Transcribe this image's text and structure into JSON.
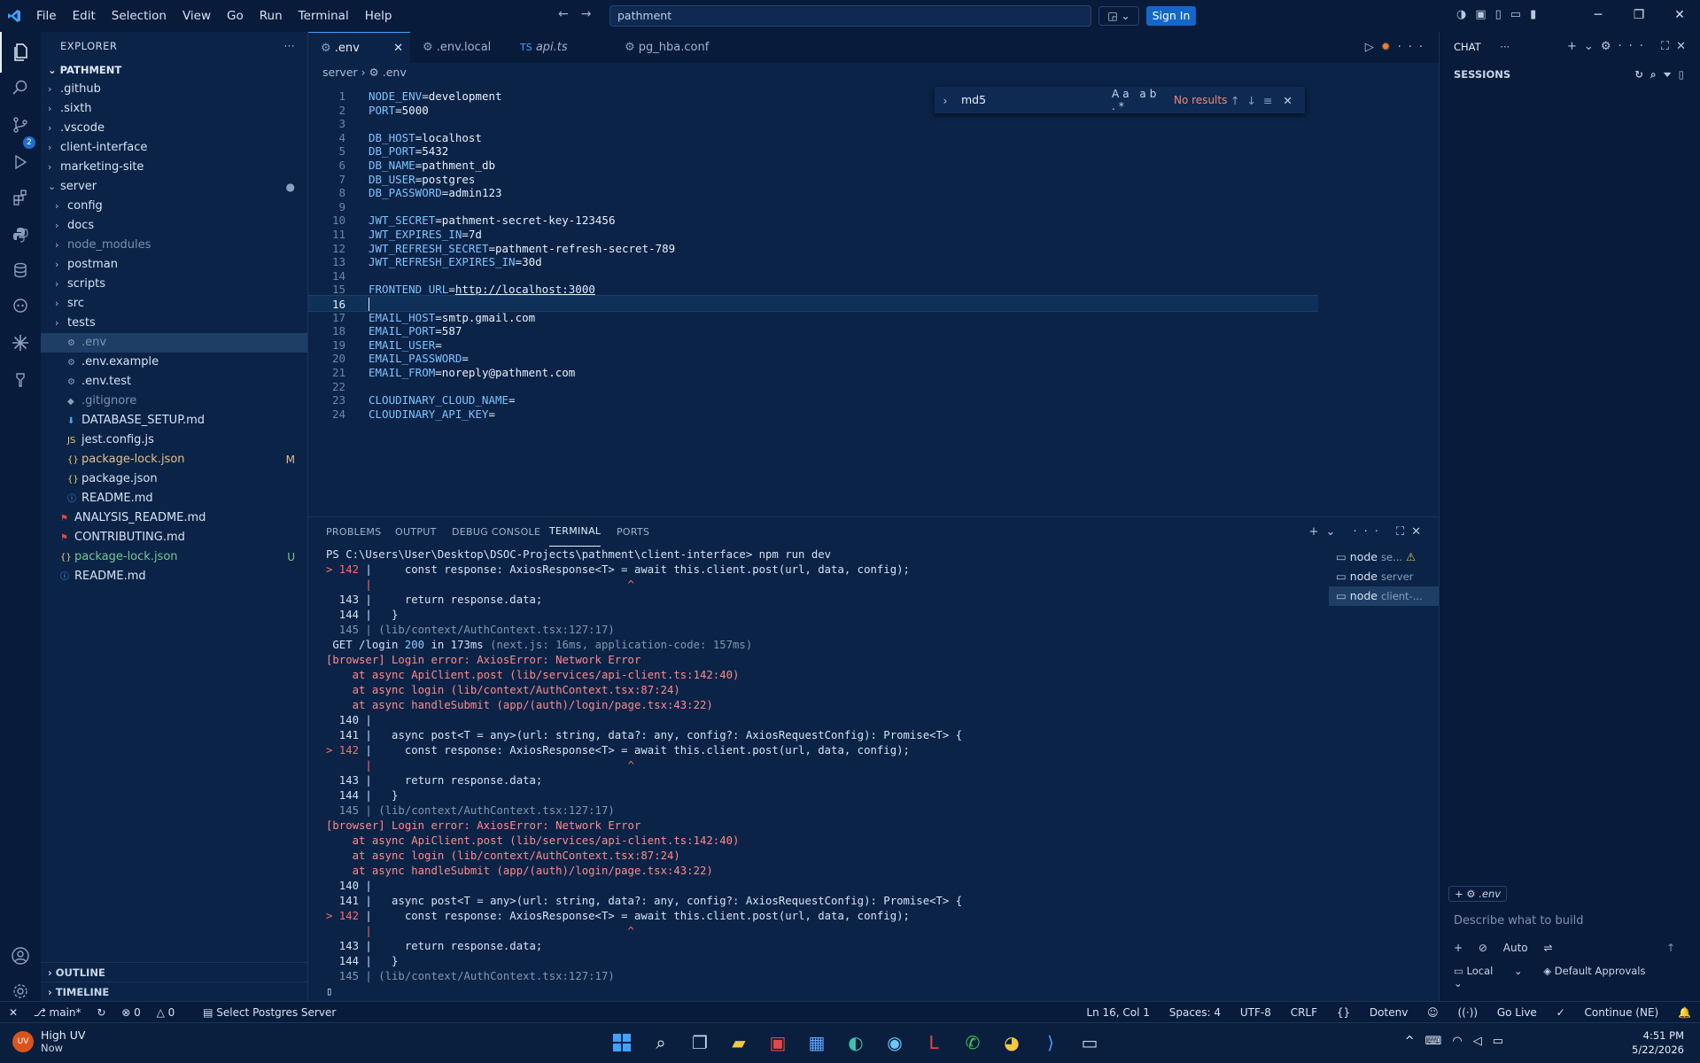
{
  "titlebar": {
    "menu": [
      "File",
      "Edit",
      "Selection",
      "View",
      "Go",
      "Run",
      "Terminal",
      "Help"
    ],
    "search": "pathment",
    "sign_in": "Sign In"
  },
  "activity_bar": {
    "items": [
      "explorer-icon",
      "search-icon",
      "source-control-icon",
      "run-debug-icon",
      "extensions-icon",
      "python-icon",
      "database-icon",
      "copilot-icon",
      "docker-icon",
      "testing-icon"
    ],
    "scm_badge": "2",
    "bottom": [
      "account-icon",
      "settings-icon"
    ]
  },
  "explorer": {
    "header": "EXPLORER",
    "folder": "PATHMENT",
    "items": [
      {
        "name": ".github",
        "kind": "folder",
        "indent": 1
      },
      {
        "name": ".sixth",
        "kind": "folder",
        "indent": 1
      },
      {
        "name": ".vscode",
        "kind": "folder",
        "indent": 1
      },
      {
        "name": "client-interface",
        "kind": "folder",
        "indent": 1
      },
      {
        "name": "marketing-site",
        "kind": "folder",
        "indent": 1
      },
      {
        "name": "server",
        "kind": "folder-open",
        "indent": 1
      },
      {
        "name": "config",
        "kind": "folder",
        "indent": 2
      },
      {
        "name": "docs",
        "kind": "folder",
        "indent": 2
      },
      {
        "name": "node_modules",
        "kind": "folder",
        "indent": 2
      },
      {
        "name": "postman",
        "kind": "folder",
        "indent": 2
      },
      {
        "name": "scripts",
        "kind": "folder",
        "indent": 2
      },
      {
        "name": "src",
        "kind": "folder",
        "indent": 2
      },
      {
        "name": "tests",
        "kind": "folder",
        "indent": 2
      },
      {
        "name": ".env",
        "kind": "file",
        "indent": 2
      },
      {
        "name": ".env.example",
        "kind": "file",
        "indent": 2
      },
      {
        "name": ".env.test",
        "kind": "file",
        "indent": 2
      },
      {
        "name": ".gitignore",
        "kind": "file",
        "indent": 2
      },
      {
        "name": "DATABASE_SETUP.md",
        "kind": "file",
        "indent": 2
      },
      {
        "name": "jest.config.js",
        "kind": "file",
        "indent": 2
      },
      {
        "name": "package-lock.json",
        "kind": "file",
        "indent": 2,
        "decoration": "M"
      },
      {
        "name": "package.json",
        "kind": "file",
        "indent": 2
      },
      {
        "name": "README.md",
        "kind": "file",
        "indent": 2
      },
      {
        "name": "ANALYSIS_README.md",
        "kind": "file",
        "indent": 1
      },
      {
        "name": "CONTRIBUTING.md",
        "kind": "file",
        "indent": 1
      },
      {
        "name": "package-lock.json",
        "kind": "file",
        "indent": 1,
        "decoration": "U"
      },
      {
        "name": "README.md",
        "kind": "file",
        "indent": 1
      }
    ],
    "outline": "OUTLINE",
    "timeline": "TIMELINE"
  },
  "tabs": [
    {
      "label": ".env",
      "active": true
    },
    {
      "label": ".env.local",
      "active": false
    },
    {
      "label": "api.ts",
      "active": false,
      "prefix": "TS"
    },
    {
      "label": "pg_hba.conf",
      "active": false
    }
  ],
  "breadcrumb": {
    "folder": "server",
    "file": ".env"
  },
  "find": {
    "query": "md5",
    "result": "No results",
    "options": "Aa ab .*"
  },
  "editor": {
    "current_line": 16,
    "lines": [
      {
        "key": "NODE_ENV",
        "value": "development"
      },
      {
        "key": "PORT",
        "value": "5000"
      },
      {
        "key": "",
        "value": ""
      },
      {
        "key": "DB_HOST",
        "value": "localhost"
      },
      {
        "key": "DB_PORT",
        "value": "5432"
      },
      {
        "key": "DB_NAME",
        "value": "pathment_db"
      },
      {
        "key": "DB_USER",
        "value": "postgres"
      },
      {
        "key": "DB_PASSWORD",
        "value": "admin123"
      },
      {
        "key": "",
        "value": ""
      },
      {
        "key": "JWT_SECRET",
        "value": "pathment-secret-key-123456"
      },
      {
        "key": "JWT_EXPIRES_IN",
        "value": "7d"
      },
      {
        "key": "JWT_REFRESH_SECRET",
        "value": "pathment-refresh-secret-789"
      },
      {
        "key": "JWT_REFRESH_EXPIRES_IN",
        "value": "30d"
      },
      {
        "key": "",
        "value": ""
      },
      {
        "key": "FRONTEND_URL",
        "value": "http://localhost:3000",
        "link": true
      },
      {
        "key": "",
        "value": ""
      },
      {
        "key": "EMAIL_HOST",
        "value": "smtp.gmail.com"
      },
      {
        "key": "EMAIL_PORT",
        "value": "587"
      },
      {
        "key": "EMAIL_USER",
        "value": ""
      },
      {
        "key": "EMAIL_PASSWORD",
        "value": ""
      },
      {
        "key": "EMAIL_FROM",
        "value": "noreply@pathment.com"
      },
      {
        "key": "",
        "value": ""
      },
      {
        "key": "CLOUDINARY_CLOUD_NAME",
        "value": ""
      },
      {
        "key": "CLOUDINARY_API_KEY",
        "value": ""
      }
    ]
  },
  "panel": {
    "tabs": [
      "PROBLEMS",
      "OUTPUT",
      "DEBUG CONSOLE",
      "TERMINAL",
      "PORTS"
    ],
    "active_tab": "TERMINAL",
    "terminals": [
      {
        "name": "node",
        "sub": "se...",
        "warn": true
      },
      {
        "name": "node",
        "sub": "server"
      },
      {
        "name": "node",
        "sub": "client-...",
        "active": true
      }
    ],
    "terminal_lines": [
      {
        "type": "normal",
        "text": "PS C:\\Users\\User\\Desktop\\DSOC-Projects\\pathment\\client-interface> npm run dev"
      },
      {
        "type": "code",
        "marker": "> 142 ",
        "text": "|     const response: AxiosResponse<T> = await this.client.post(url, data, config);"
      },
      {
        "type": "caret",
        "text": "      |                                       ^"
      },
      {
        "type": "code",
        "marker": "  143 ",
        "text": "|     return response.data;"
      },
      {
        "type": "code",
        "marker": "  144 ",
        "text": "|   }"
      },
      {
        "type": "gray",
        "text": "  145 | (lib/context/AuthContext.tsx:127:17)"
      },
      {
        "type": "get",
        "text": " GET /login 200 in 173ms (next.js: 16ms, application-code: 157ms)"
      },
      {
        "type": "err",
        "text": "[browser] Login error: AxiosError: Network Error"
      },
      {
        "type": "err",
        "text": "    at async ApiClient.post (lib/services/api-client.ts:142:40)"
      },
      {
        "type": "err",
        "text": "    at async login (lib/context/AuthContext.tsx:87:24)"
      },
      {
        "type": "err",
        "text": "    at async handleSubmit (app/(auth)/login/page.tsx:43:22)"
      },
      {
        "type": "code",
        "marker": "  140 ",
        "text": "|"
      },
      {
        "type": "code",
        "marker": "  141 ",
        "text": "|   async post<T = any>(url: string, data?: any, config?: AxiosRequestConfig): Promise<T> {"
      },
      {
        "type": "code",
        "marker": "> 142 ",
        "text": "|     const response: AxiosResponse<T> = await this.client.post(url, data, config);"
      },
      {
        "type": "caret",
        "text": "      |                                       ^"
      },
      {
        "type": "code",
        "marker": "  143 ",
        "text": "|     return response.data;"
      },
      {
        "type": "code",
        "marker": "  144 ",
        "text": "|   }"
      },
      {
        "type": "gray",
        "text": "  145 | (lib/context/AuthContext.tsx:127:17)"
      },
      {
        "type": "err",
        "text": "[browser] Login error: AxiosError: Network Error"
      },
      {
        "type": "err",
        "text": "    at async ApiClient.post (lib/services/api-client.ts:142:40)"
      },
      {
        "type": "err",
        "text": "    at async login (lib/context/AuthContext.tsx:87:24)"
      },
      {
        "type": "err",
        "text": "    at async handleSubmit (app/(auth)/login/page.tsx:43:22)"
      },
      {
        "type": "code",
        "marker": "  140 ",
        "text": "|"
      },
      {
        "type": "code",
        "marker": "  141 ",
        "text": "|   async post<T = any>(url: string, data?: any, config?: AxiosRequestConfig): Promise<T> {"
      },
      {
        "type": "code",
        "marker": "> 142 ",
        "text": "|     const response: AxiosResponse<T> = await this.client.post(url, data, config);"
      },
      {
        "type": "caret",
        "text": "      |                                       ^"
      },
      {
        "type": "code",
        "marker": "  143 ",
        "text": "|     return response.data;"
      },
      {
        "type": "code",
        "marker": "  144 ",
        "text": "|   }"
      },
      {
        "type": "gray",
        "text": "  145 | (lib/context/AuthContext.tsx:127:17)"
      }
    ]
  },
  "chat": {
    "title": "CHAT",
    "sessions": "SESSIONS",
    "context": ".env",
    "placeholder": "Describe what to build",
    "mode": "Auto",
    "location": "Local",
    "approvals": "Default Approvals"
  },
  "statusbar": {
    "branch": "main*",
    "problems": "0",
    "warnings": "0",
    "db": "Select Postgres Server",
    "position": "Ln 16, Col 1",
    "spaces": "Spaces: 4",
    "encoding": "UTF-8",
    "eol": "CRLF",
    "language": "Dotenv",
    "golive": "Go Live",
    "continue": "Continue (NE)"
  },
  "taskbar": {
    "weather_title": "High UV",
    "weather_sub": "Now",
    "weather_badge": "UV",
    "time": "4:51 PM",
    "date": "5/22/2026"
  }
}
